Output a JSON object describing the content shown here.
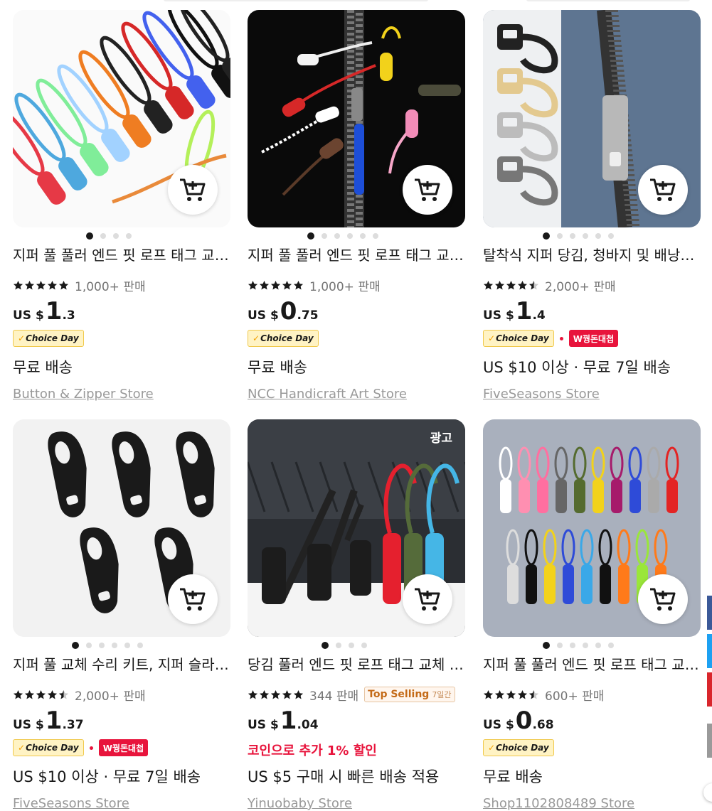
{
  "ui": {
    "cart_icon": "add-to-cart-icon",
    "rating_stars_icon": "star-icon",
    "ad_label": "광고",
    "choice_badge": "Choice Day",
    "colors": {
      "accent_red": "#e8143c",
      "choice_yellow": "#fff3c4"
    }
  },
  "products": [
    {
      "title": "지퍼 풀 풀러 엔드 핏 로프 태그 교체 클립 스포츠 가방 지퍼 헤드",
      "rating": 5,
      "sold": "1,000+ 판매",
      "price_currency": "US $",
      "price_int": "1",
      "price_dec": ".3",
      "shipping": "무료 배송",
      "store": "Button & Zipper Store",
      "dots_total": 4,
      "dots_active": 0
    },
    {
      "title": "지퍼 풀 풀러 엔드 핏 로프 태그 교체 클립 배낭 지퍼 헤드",
      "rating": 5,
      "sold": "1,000+ 판매",
      "price_currency": "US $",
      "price_int": "0",
      "price_dec": ".75",
      "shipping": "무료 배송",
      "store": "NCC Handicraft Art Store",
      "dots_total": 6,
      "dots_active": 0
    },
    {
      "title": "탈착식 지퍼 당김, 청바지 및 배낭용 금속 지퍼 헤드",
      "rating": 4.5,
      "sold": "2,000+ 판매",
      "price_currency": "US $",
      "price_int": "1",
      "price_dec": ".4",
      "promo": "W꿩돈대첩",
      "shipping": "US $10 이상 · 무료 7일 배송",
      "store": "FiveSeasons Store",
      "dots_total": 6,
      "dots_active": 0
    },
    {
      "title": "지퍼 풀 교체 수리 키트, 지퍼 슬라이더 탈착식 금속",
      "rating": 4.5,
      "sold": "2,000+ 판매",
      "price_currency": "US $",
      "price_int": "1",
      "price_dec": ".37",
      "promo": "W꿩돈대첩",
      "shipping": "US $10 이상 · 무료 7일 배송",
      "store": "FiveSeasons Store",
      "dots_total": 6,
      "dots_active": 0
    },
    {
      "title": "당김 풀러 엔드 핏 로프 태그 교체 클립 배낭 가방",
      "rating": 5,
      "sold": "344 판매",
      "top_selling": "Top Selling",
      "top_selling_period": "7일간",
      "price_currency": "US $",
      "price_int": "1",
      "price_dec": ".04",
      "coin_text": "코인으로 추가 1% 할인",
      "shipping": "US $5 구매 시 빠른 배송 적용",
      "store": "Yinuobaby Store",
      "ad": true,
      "dots_total": 4,
      "dots_active": 0
    },
    {
      "title": "지퍼 풀 풀러 엔드 핏 로프 태그 교체 클립 가방",
      "rating": 4.5,
      "sold": "600+ 판매",
      "price_currency": "US $",
      "price_int": "0",
      "price_dec": ".68",
      "shipping": "무료 배송",
      "store": "Shop1102808489 Store",
      "dots_total": 6,
      "dots_active": 0
    }
  ]
}
